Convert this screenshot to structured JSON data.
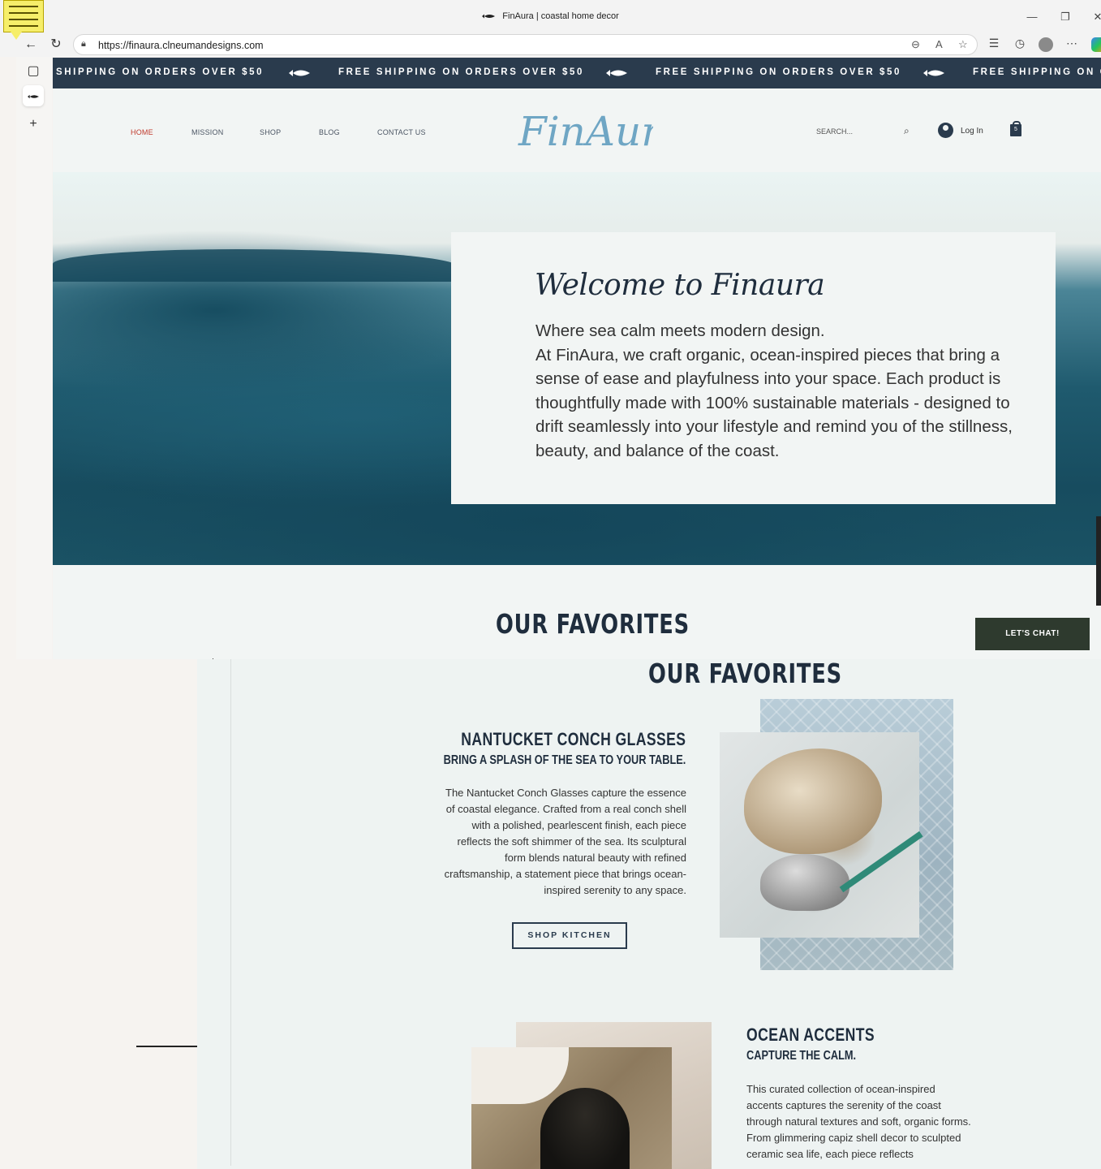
{
  "browser": {
    "tab_title": "FinAura | coastal home decor",
    "url": "https://finaura.clneumandesigns.com",
    "window_controls": {
      "minimize": "—",
      "restore": "❐",
      "close": "✕"
    }
  },
  "site": {
    "marquee_items": [
      "SHIPPING ON ORDERS OVER $50",
      "FREE SHIPPING ON ORDERS OVER $50",
      "FREE SHIPPING ON ORDERS OVER $50",
      "FREE SHIPPING ON O"
    ],
    "nav": [
      {
        "label": "HOME",
        "active": true
      },
      {
        "label": "MISSION",
        "active": false
      },
      {
        "label": "SHOP",
        "active": false
      },
      {
        "label": "BLOG",
        "active": false
      },
      {
        "label": "CONTACT US",
        "active": false
      }
    ],
    "logo_text": "FinAura",
    "search_placeholder": "SEARCH...",
    "login_label": "Log In",
    "cart_count": "5",
    "hero": {
      "heading": "Welcome to Finaura",
      "lead": "Where sea calm meets modern design.",
      "body": "At FinAura, we craft organic, ocean-inspired pieces that bring a sense of ease and playfulness into your space. Each product is thoughtfully made with 100% sustainable materials - designed to drift seamlessly into your lifestyle and remind you of the stillness, beauty, and balance of the coast."
    },
    "favorites_heading": "OUR FAVORITES",
    "chat_label": "LET'S CHAT!"
  },
  "lower": {
    "favorites_heading": "OUR FAVORITES",
    "product1": {
      "title": "NANTUCKET CONCH GLASSES",
      "subtitle": "BRING A SPLASH OF THE SEA TO YOUR TABLE.",
      "text": "The Nantucket Conch Glasses capture the essence of coastal elegance. Crafted from a real conch shell with a polished, pearlescent finish, each piece reflects the soft shimmer of the sea. Its sculptural form blends natural beauty with refined craftsmanship, a statement piece that brings ocean-inspired serenity to any space.",
      "button": "SHOP KITCHEN"
    },
    "product2": {
      "title": "OCEAN ACCENTS",
      "subtitle": "CAPTURE THE CALM.",
      "text": "This curated collection of ocean-inspired accents captures the serenity of the coast through natural textures and soft, organic forms. From glimmering capiz shell decor to sculpted ceramic sea life, each piece reflects"
    }
  },
  "colors": {
    "marquee_bg": "#2a3b4d",
    "nav_active": "#c0392b",
    "logo": "#6fa6c4",
    "chat_bg": "#2e3a2e"
  }
}
